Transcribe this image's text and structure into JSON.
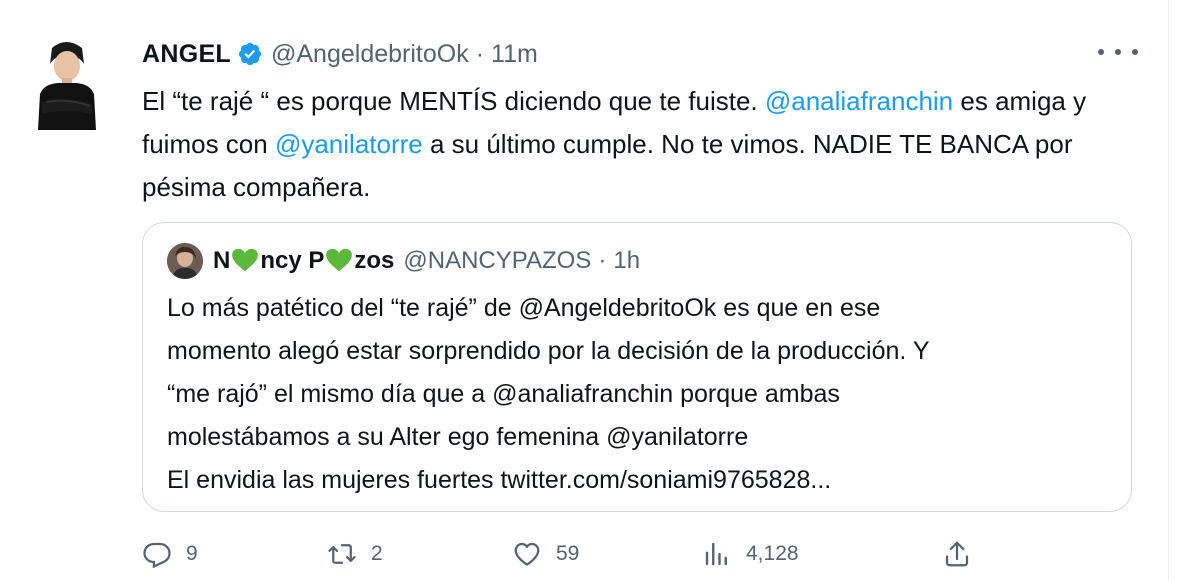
{
  "tweet": {
    "author_name": "ANGEL",
    "author_handle": "@AngeldebritoOk",
    "separator": "·",
    "time": "11m",
    "text_parts": [
      {
        "text": "El “te rajé “ es porque MENTÍS diciendo que te fuiste. ",
        "type": "plain"
      },
      {
        "text": "@analiafranchin",
        "type": "mention"
      },
      {
        "text": " es amiga y fuimos con ",
        "type": "plain"
      },
      {
        "text": "@yanilatorre",
        "type": "mention"
      },
      {
        "text": " a su último cumple. No te vimos. NADIE TE BANCA por pésima compañera.",
        "type": "plain"
      }
    ]
  },
  "quote": {
    "name_parts": [
      "N",
      "ncy P",
      "zos"
    ],
    "handle": "@NANCYPAZOS",
    "separator": "·",
    "time": "1h",
    "lines": [
      "Lo más patético del “te rajé” de @AngeldebritoOk es que en ese",
      "momento alegó estar sorprendido por la decisión de la producción.  Y",
      "“me rajó” el mismo día que a @analiafranchin porque ambas",
      "molestábamos a su Alter ego femenina @yanilatorre",
      "El envidia las mujeres fuertes twitter.com/soniami9765828..."
    ]
  },
  "actions": {
    "replies": "9",
    "retweets": "2",
    "likes": "59",
    "views": "4,128"
  },
  "colors": {
    "link": "#1d9bf0",
    "verified": "#1d9bf0",
    "heart_emoji": "#5cb83a",
    "secondary_text": "#536471",
    "border": "#cfd9de"
  },
  "icons": {
    "reply": "reply-icon",
    "retweet": "retweet-icon",
    "like": "like-icon",
    "views": "views-icon",
    "share": "share-icon",
    "more": "more-icon",
    "verified": "verified-badge-icon",
    "heart": "green-heart-icon"
  }
}
